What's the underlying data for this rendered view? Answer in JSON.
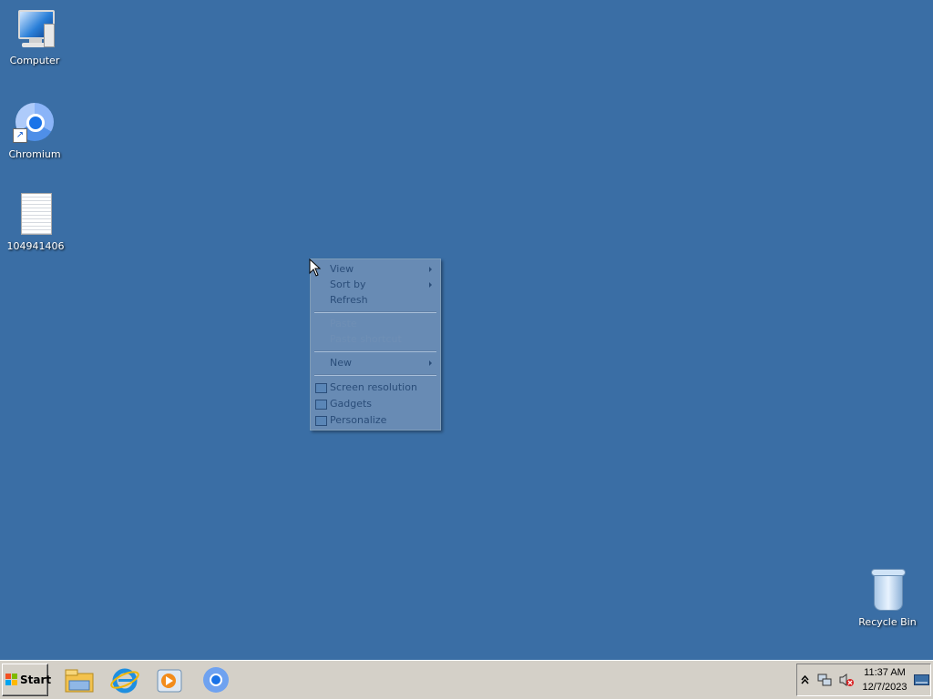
{
  "desktop": {
    "background": "#3a6ea5",
    "icons": [
      {
        "label": "Computer",
        "icon": "computer-icon"
      },
      {
        "label": "Chromium",
        "icon": "chromium-icon"
      },
      {
        "label": "104941406",
        "icon": "document-icon"
      },
      {
        "label": "Recycle Bin",
        "icon": "recycle-bin-icon"
      }
    ]
  },
  "context_menu": {
    "items": [
      {
        "label": "View",
        "submenu": true,
        "enabled": true
      },
      {
        "label": "Sort by",
        "submenu": true,
        "enabled": true
      },
      {
        "label": "Refresh",
        "submenu": false,
        "enabled": true
      },
      {
        "label": "Paste",
        "submenu": false,
        "enabled": false
      },
      {
        "label": "Paste shortcut",
        "submenu": false,
        "enabled": false
      },
      {
        "label": "New",
        "submenu": true,
        "enabled": true
      },
      {
        "label": "Screen resolution",
        "submenu": false,
        "enabled": true,
        "icon": "screen-resolution-icon"
      },
      {
        "label": "Gadgets",
        "submenu": false,
        "enabled": true,
        "icon": "gadgets-icon"
      },
      {
        "label": "Personalize",
        "submenu": false,
        "enabled": true,
        "icon": "personalize-icon"
      }
    ]
  },
  "taskbar": {
    "start_label": "Start",
    "pinned": [
      "file-explorer-icon",
      "internet-explorer-icon",
      "media-player-icon",
      "chromium-icon"
    ],
    "tray": {
      "icons": [
        "show-hidden-icons-icon",
        "network-icon",
        "volume-muted-icon"
      ],
      "time": "11:37 AM",
      "date": "12/7/2023"
    }
  }
}
